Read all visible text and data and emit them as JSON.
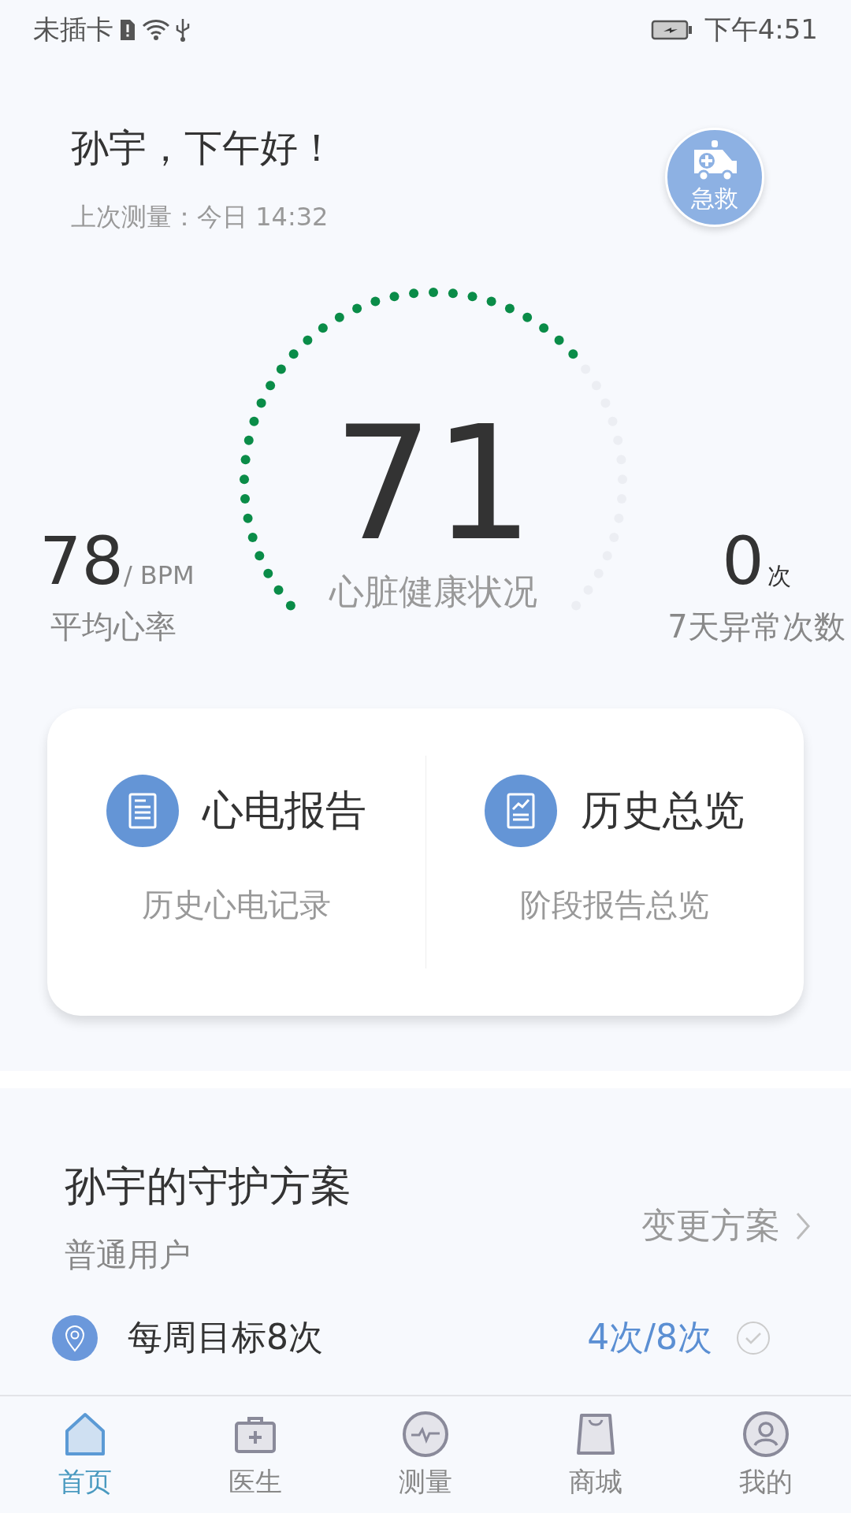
{
  "status_bar": {
    "carrier": "未插卡",
    "time": "下午4:51"
  },
  "header": {
    "greeting": "孙宇，下午好！",
    "last_measure": "上次测量：今日 14:32",
    "emergency_button": "急救"
  },
  "gauge": {
    "score": "71",
    "label": "心脏健康状况"
  },
  "stats": [
    {
      "value": "78",
      "unit": "/ BPM",
      "label": "平均心率"
    },
    {
      "value": "0",
      "unit": "次",
      "label": "7天异常次数"
    }
  ],
  "cards": [
    {
      "kind": "report",
      "title": "心电报告",
      "subtitle": "历史心电记录"
    },
    {
      "kind": "history",
      "title": "历史总览",
      "subtitle": "阶段报告总览"
    }
  ],
  "plan": {
    "title": "孙宇的守护方案",
    "level_name": "普通用户",
    "change_link": "变更方案",
    "goal": {
      "text": "每周目标8次",
      "progress": "4次/8次",
      "done": false
    }
  },
  "tabs": [
    {
      "kind": "home",
      "label": "首页",
      "selected": true
    },
    {
      "kind": "doctor",
      "label": "医生",
      "selected": false
    },
    {
      "kind": "measure",
      "label": "测量",
      "selected": false
    },
    {
      "kind": "shop",
      "label": "商城",
      "selected": false
    },
    {
      "kind": "me",
      "label": "我的",
      "selected": false
    }
  ]
}
